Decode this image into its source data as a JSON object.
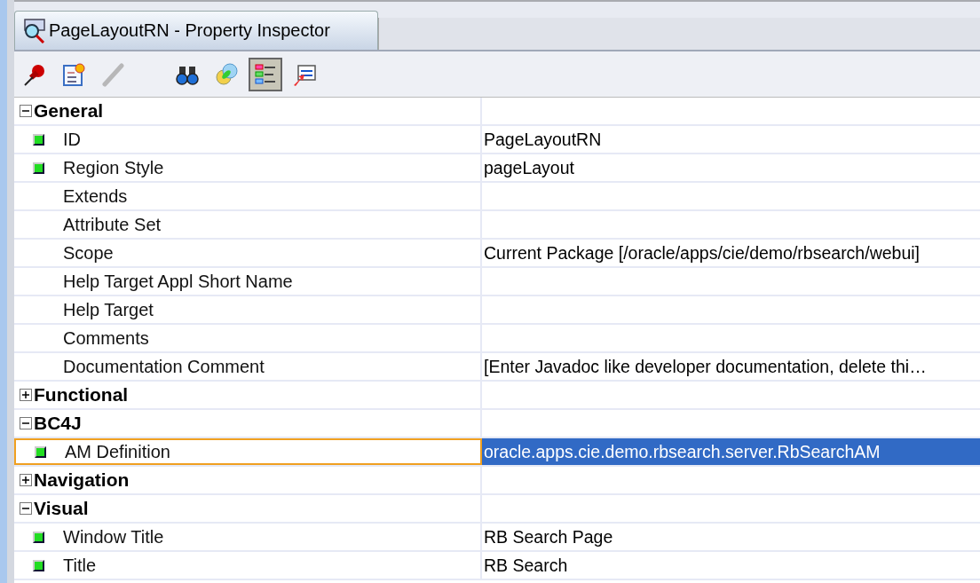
{
  "tab": {
    "title": "PageLayoutRN - Property Inspector"
  },
  "toolbar": [
    {
      "selected": false,
      "disabled": false
    },
    {
      "selected": false,
      "disabled": false
    },
    {
      "selected": false,
      "disabled": true
    },
    {
      "selected": false,
      "disabled": false
    },
    {
      "selected": false,
      "disabled": false
    },
    {
      "selected": true,
      "disabled": false
    },
    {
      "selected": false,
      "disabled": false
    }
  ],
  "sections": [
    {
      "name": "General",
      "expanded": true,
      "properties": [
        {
          "name": "ID",
          "value": "PageLayoutRN",
          "set": true,
          "selected": false
        },
        {
          "name": "Region Style",
          "value": "pageLayout",
          "set": true,
          "selected": false
        },
        {
          "name": "Extends",
          "set": false,
          "selected": false
        },
        {
          "name": "Attribute Set",
          "set": false,
          "selected": false
        },
        {
          "name": "Scope",
          "value": "Current Package [/oracle/apps/cie/demo/rbsearch/webui]",
          "set": false,
          "selected": false
        },
        {
          "name": "Help Target Appl Short Name",
          "set": false,
          "selected": false
        },
        {
          "name": "Help Target",
          "set": false,
          "selected": false
        },
        {
          "name": "Comments",
          "set": false,
          "selected": false
        },
        {
          "name": "Documentation Comment",
          "value": "[Enter Javadoc like developer documentation, delete thi…",
          "set": false,
          "selected": false
        }
      ]
    },
    {
      "name": "Functional",
      "expanded": false
    },
    {
      "name": "BC4J",
      "expanded": true,
      "properties": [
        {
          "name": "AM Definition",
          "value": "oracle.apps.cie.demo.rbsearch.server.RbSearchAM",
          "set": true,
          "selected": true
        }
      ]
    },
    {
      "name": "Navigation",
      "expanded": false
    },
    {
      "name": "Visual",
      "expanded": true,
      "properties": [
        {
          "name": "Window Title",
          "value": "RB Search Page",
          "set": true,
          "selected": false
        },
        {
          "name": "Title",
          "value": "RB Search",
          "set": true,
          "selected": false
        }
      ]
    }
  ]
}
